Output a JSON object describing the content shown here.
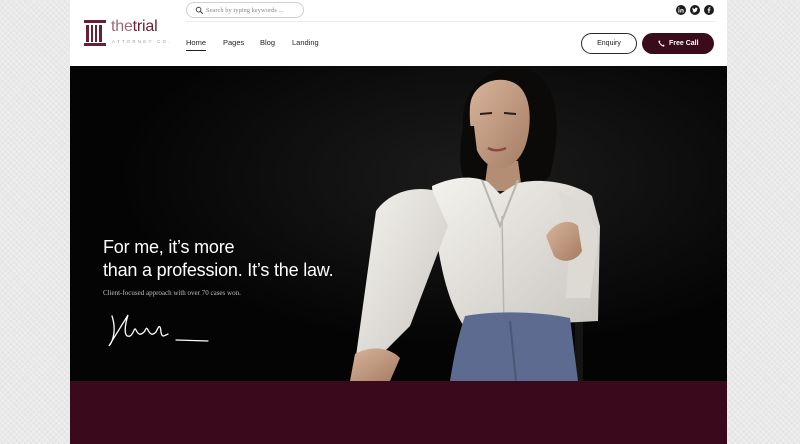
{
  "brand": {
    "name_light": "the",
    "name_bold": "trial",
    "tagline": "ATTORNEY CO."
  },
  "search": {
    "placeholder": "Search by typing keywords ..."
  },
  "social": [
    {
      "name": "linkedin-icon",
      "glyph": "in"
    },
    {
      "name": "twitter-icon",
      "glyph": ""
    },
    {
      "name": "facebook-icon",
      "glyph": "f"
    }
  ],
  "nav": {
    "items": [
      {
        "label": "Home",
        "active": true
      },
      {
        "label": "Pages",
        "active": false
      },
      {
        "label": "Blog",
        "active": false
      },
      {
        "label": "Landing",
        "active": false
      }
    ]
  },
  "actions": {
    "enquiry_label": "Enquiry",
    "call_label": "Free Call"
  },
  "hero": {
    "title_line1": "For me, it’s more",
    "title_line2": "than a profession. It’s the law.",
    "subtitle": "Client-focused approach with over 70 cases won."
  },
  "colors": {
    "brand": "#3a0c1b",
    "band": "#3a0a1c",
    "hero_bg": "#050505"
  }
}
